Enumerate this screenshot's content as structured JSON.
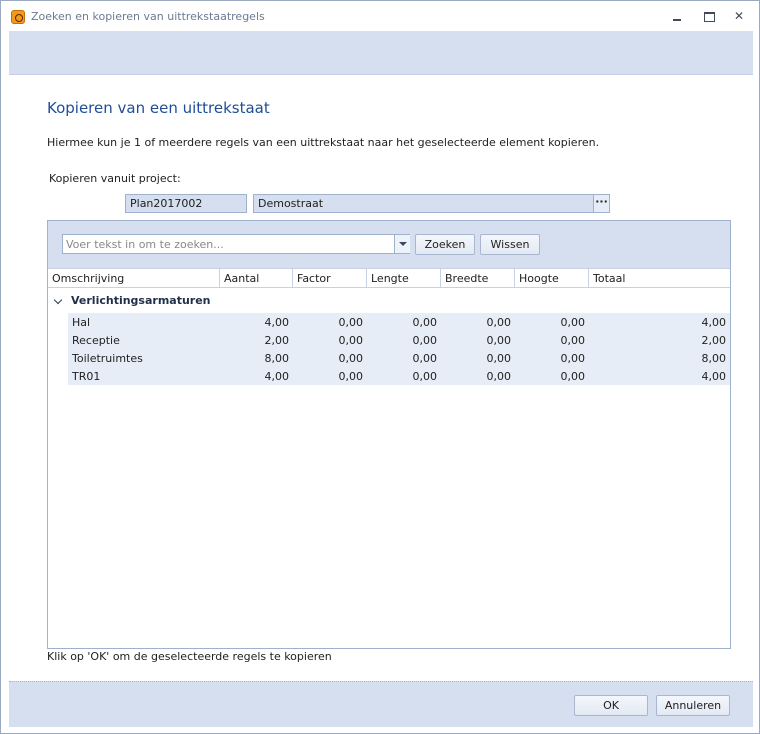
{
  "window": {
    "title": "Zoeken en kopieren van uittrekstaatregels",
    "icon": "app-logo-icon"
  },
  "heading": "Kopieren van een uittrekstaat",
  "intro": "Hiermee kun je 1 of meerdere regels van een uittrekstaat naar het geselecteerde element kopieren.",
  "project": {
    "label": "Kopieren vanuit project:",
    "code": "Plan2017002",
    "name": "Demostraat",
    "browse_label": "···"
  },
  "search": {
    "placeholder": "Voer tekst in om te zoeken...",
    "search_button": "Zoeken",
    "clear_button": "Wissen"
  },
  "grid": {
    "columns": [
      "Omschrijving",
      "Aantal",
      "Factor",
      "Lengte",
      "Breedte",
      "Hoogte",
      "Totaal"
    ],
    "group": "Verlichtingsarmaturen",
    "rows": [
      {
        "omschrijving": "Hal",
        "aantal": "4,00",
        "factor": "0,00",
        "lengte": "0,00",
        "breedte": "0,00",
        "hoogte": "0,00",
        "totaal": "4,00"
      },
      {
        "omschrijving": "Receptie",
        "aantal": "2,00",
        "factor": "0,00",
        "lengte": "0,00",
        "breedte": "0,00",
        "hoogte": "0,00",
        "totaal": "2,00"
      },
      {
        "omschrijving": "Toiletruimtes",
        "aantal": "8,00",
        "factor": "0,00",
        "lengte": "0,00",
        "breedte": "0,00",
        "hoogte": "0,00",
        "totaal": "8,00"
      },
      {
        "omschrijving": "TR01",
        "aantal": "4,00",
        "factor": "0,00",
        "lengte": "0,00",
        "breedte": "0,00",
        "hoogte": "0,00",
        "totaal": "4,00"
      }
    ]
  },
  "footer_note": "Klik op 'OK' om de geselecteerde regels te kopieren",
  "buttons": {
    "ok": "OK",
    "cancel": "Annuleren"
  }
}
